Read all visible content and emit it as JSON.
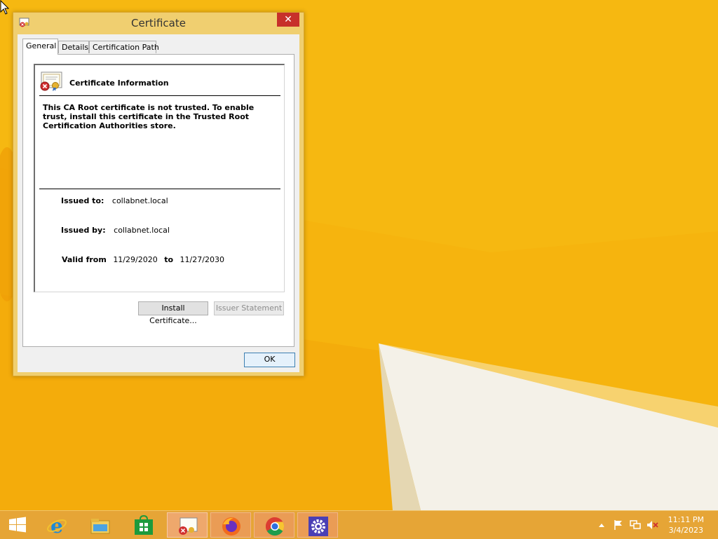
{
  "dialog": {
    "title": "Certificate",
    "close_glyph": "✕",
    "tabs": [
      {
        "label": "General",
        "active": true
      },
      {
        "label": "Details",
        "active": false
      },
      {
        "label": "Certification Path",
        "active": false
      }
    ],
    "info_heading": "Certificate Information",
    "warning": "This CA Root certificate is not trusted. To enable trust, install this certificate in the Trusted Root Certification Authorities store.",
    "issued_to_label": "Issued to:",
    "issued_to_value": "collabnet.local",
    "issued_by_label": "Issued by:",
    "issued_by_value": "collabnet.local",
    "valid_from_label": "Valid from",
    "valid_from_value": "11/29/2020",
    "valid_to_label": "to",
    "valid_to_value": "11/27/2030",
    "install_button": "Install Certificate...",
    "issuer_statement_button": "Issuer Statement",
    "ok_button": "OK",
    "icons": [
      "certificate-error-icon",
      "close-icon"
    ]
  },
  "taskbar": {
    "items": [
      "start-icon",
      "internet-explorer-icon",
      "file-explorer-icon",
      "store-icon",
      "certificate-icon",
      "firefox-icon",
      "chrome-icon",
      "settings-icon"
    ],
    "tray_icons": [
      "show-hidden-icons-icon",
      "action-center-flag-icon",
      "network-icon",
      "volume-muted-icon"
    ],
    "clock_time": "11:11 PM",
    "clock_date": "3/4/2023"
  },
  "colors": {
    "desktop": "#f6b40e",
    "taskbar": "#e6a536",
    "dialog_frame": "#f0cf70",
    "close_button": "#c7302a"
  }
}
